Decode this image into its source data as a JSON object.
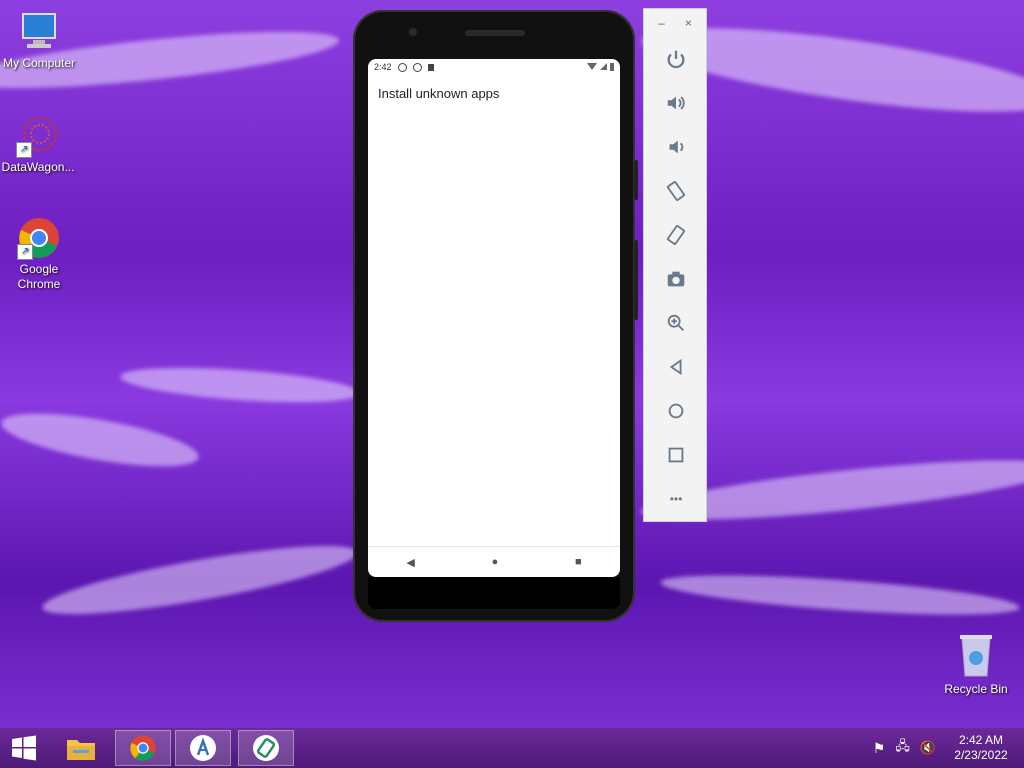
{
  "desktop": {
    "icons": [
      {
        "label": "My Computer"
      },
      {
        "label": "DataWagon..."
      },
      {
        "label": "Google Chrome"
      },
      {
        "label": "Recycle Bin"
      }
    ]
  },
  "emulator": {
    "status_time": "2:42",
    "page_title": "Install unknown apps",
    "nav": {
      "back": "◀",
      "home": "●",
      "recents": "■"
    },
    "toolbar": {
      "minimize": "–",
      "close": "×",
      "buttons": [
        "power-icon",
        "volume-up-icon",
        "volume-down-icon",
        "rotate-left-icon",
        "rotate-right-icon",
        "camera-icon",
        "zoom-icon",
        "back-icon",
        "home-icon",
        "overview-icon",
        "more-icon"
      ],
      "more_label": "•••"
    }
  },
  "taskbar": {
    "clock_time": "2:42 AM",
    "clock_date": "2/23/2022"
  },
  "colors": {
    "wallpaper": "#7a2fd0",
    "taskbar": "#5a1f88"
  }
}
